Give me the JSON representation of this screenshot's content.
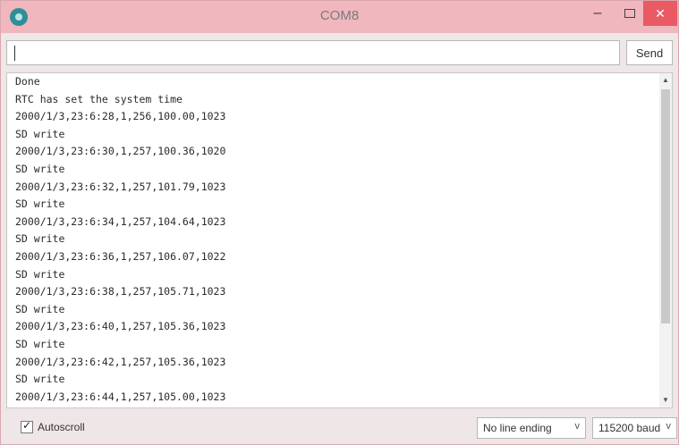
{
  "window": {
    "title": "COM8",
    "minimize_label": "–",
    "close_label": "✕"
  },
  "input": {
    "value": ""
  },
  "toolbar": {
    "send_label": "Send"
  },
  "serial_output": {
    "lines": [
      "Done",
      "RTC has set the system time",
      "2000/1/3,23:6:28,1,256,100.00,1023",
      "SD write",
      "2000/1/3,23:6:30,1,257,100.36,1020",
      "SD write",
      "2000/1/3,23:6:32,1,257,101.79,1023",
      "SD write",
      "2000/1/3,23:6:34,1,257,104.64,1023",
      "SD write",
      "2000/1/3,23:6:36,1,257,106.07,1022",
      "SD write",
      "2000/1/3,23:6:38,1,257,105.71,1023",
      "SD write",
      "2000/1/3,23:6:40,1,257,105.36,1023",
      "SD write",
      "2000/1/3,23:6:42,1,257,105.36,1023",
      "SD write",
      "2000/1/3,23:6:44,1,257,105.00,1023"
    ]
  },
  "bottom": {
    "autoscroll_label": "Autoscroll",
    "autoscroll_checked": true,
    "line_ending": "No line ending",
    "baud_rate": "115200 baud"
  },
  "icons": {
    "app": "arduino-icon",
    "minimize": "minimize-icon",
    "maximize": "maximize-icon",
    "close": "close-icon",
    "dropdown": "chevron-down-icon"
  },
  "colors": {
    "titlebar": "#f0b7be",
    "close_button": "#e95a64",
    "app_icon": "#2f8f98"
  }
}
